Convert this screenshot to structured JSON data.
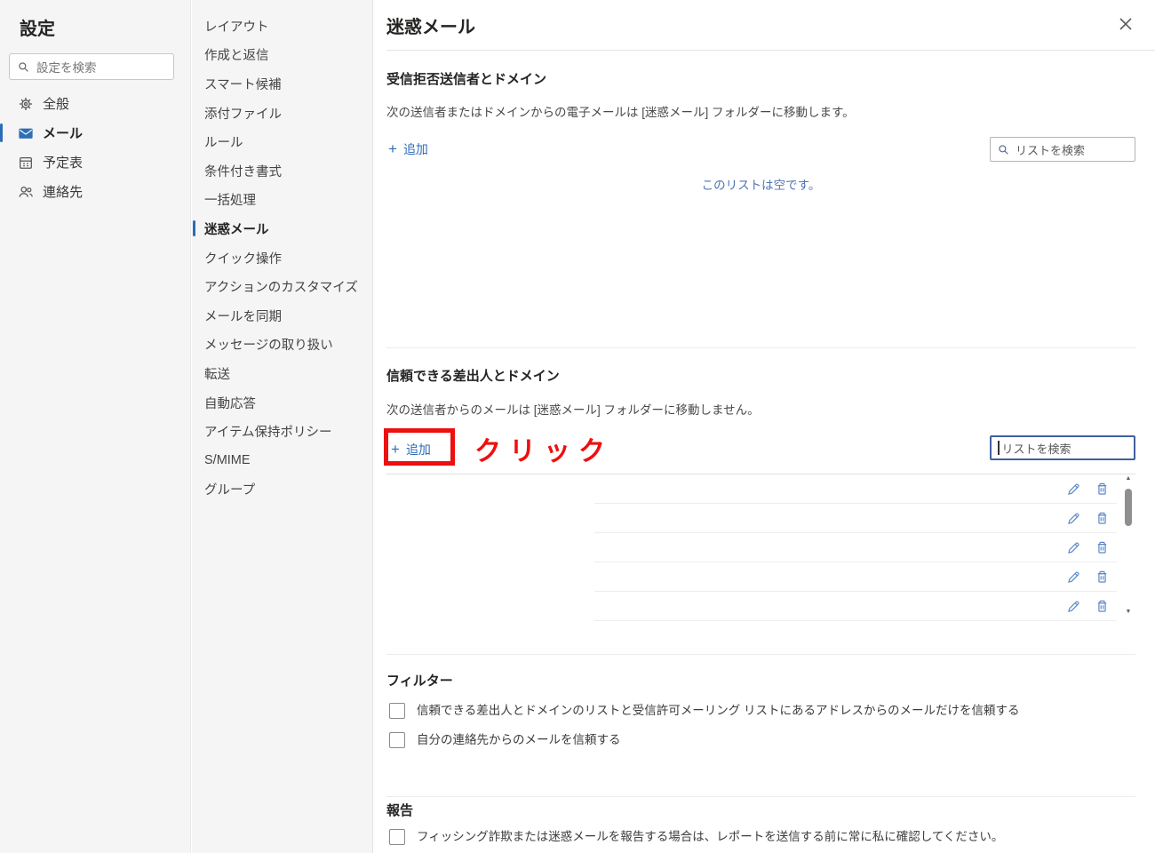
{
  "sidebar": {
    "title": "設定",
    "search_placeholder": "設定を検索",
    "items": [
      {
        "label": "全般",
        "icon": "gear",
        "selected": false
      },
      {
        "label": "メール",
        "icon": "mail",
        "selected": true
      },
      {
        "label": "予定表",
        "icon": "calendar",
        "selected": false
      },
      {
        "label": "連絡先",
        "icon": "people",
        "selected": false
      }
    ]
  },
  "nav": {
    "items": [
      {
        "label": "レイアウト",
        "selected": false
      },
      {
        "label": "作成と返信",
        "selected": false
      },
      {
        "label": "スマート候補",
        "selected": false
      },
      {
        "label": "添付ファイル",
        "selected": false
      },
      {
        "label": "ルール",
        "selected": false
      },
      {
        "label": "条件付き書式",
        "selected": false
      },
      {
        "label": "一括処理",
        "selected": false
      },
      {
        "label": "迷惑メール",
        "selected": true
      },
      {
        "label": "クイック操作",
        "selected": false
      },
      {
        "label": "アクションのカスタマイズ",
        "selected": false
      },
      {
        "label": "メールを同期",
        "selected": false
      },
      {
        "label": "メッセージの取り扱い",
        "selected": false
      },
      {
        "label": "転送",
        "selected": false
      },
      {
        "label": "自動応答",
        "selected": false
      },
      {
        "label": "アイテム保持ポリシー",
        "selected": false
      },
      {
        "label": "S/MIME",
        "selected": false
      },
      {
        "label": "グループ",
        "selected": false
      }
    ]
  },
  "panel": {
    "title": "迷惑メール",
    "close_icon": "close",
    "blocked": {
      "heading": "受信拒否送信者とドメイン",
      "description": "次の送信者またはドメインからの電子メールは [迷惑メール] フォルダーに移動します。",
      "add_label": "追加",
      "plus": "+",
      "search_placeholder": "リストを検索",
      "empty_text": "このリストは空です。"
    },
    "safe": {
      "heading": "信頼できる差出人とドメイン",
      "description": "次の送信者からのメールは [迷惑メール] フォルダーに移動しません。",
      "add_label": "追加",
      "plus": "+",
      "search_placeholder": "リストを検索",
      "visible_row_count": 5,
      "row_actions": [
        "edit",
        "delete"
      ]
    },
    "filter": {
      "heading": "フィルター",
      "options": [
        {
          "label": "信頼できる差出人とドメインのリストと受信許可メーリング リストにあるアドレスからのメールだけを信頼する",
          "checked": false
        },
        {
          "label": "自分の連絡先からのメールを信頼する",
          "checked": false
        }
      ]
    },
    "report": {
      "heading": "報告",
      "options": [
        {
          "label": "フィッシング詐欺または迷惑メールを報告する場合は、レポートを送信する前に常に私に確認してください。",
          "checked": false
        }
      ]
    }
  },
  "annotation": {
    "click_label": "クリック",
    "color": "#ee0f0f"
  },
  "colors": {
    "accent_blue": "#2b6cb8",
    "link_blue": "#2b6cb8",
    "empty_text_blue": "#4f74b3",
    "annotation_red": "#ee0f0f",
    "sidebar_bg": "#f5f5f5"
  }
}
